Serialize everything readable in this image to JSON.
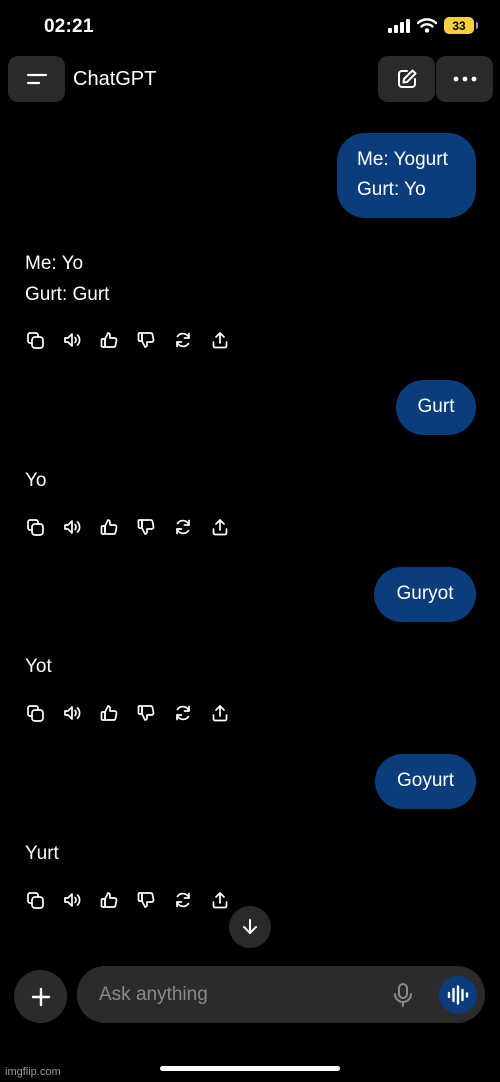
{
  "status_bar": {
    "time": "02:21",
    "battery_level": "33",
    "battery_color": "#f4d03f"
  },
  "header": {
    "title": "ChatGPT",
    "menu_icon": "menu-icon",
    "new_chat_icon": "edit-icon",
    "more_icon": "more-icon"
  },
  "conversation": {
    "user_messages": [
      "Me: Yogurt\nGurt: Yo",
      "Gurt",
      "Guryot",
      "Goyurt"
    ],
    "assistant_messages": [
      "Me: Yo\nGurt: Gurt",
      "Yo",
      "Yot",
      "Yurt"
    ],
    "action_icons": [
      "copy-icon",
      "speaker-icon",
      "thumbs-up-icon",
      "thumbs-down-icon",
      "regenerate-icon",
      "share-icon"
    ]
  },
  "composer": {
    "placeholder": "Ask anything",
    "plus_icon": "plus-icon",
    "mic_icon": "mic-icon",
    "voice_icon": "voice-mode-icon",
    "accent_color": "#0b3d7d"
  },
  "watermark": "imgflip.com"
}
